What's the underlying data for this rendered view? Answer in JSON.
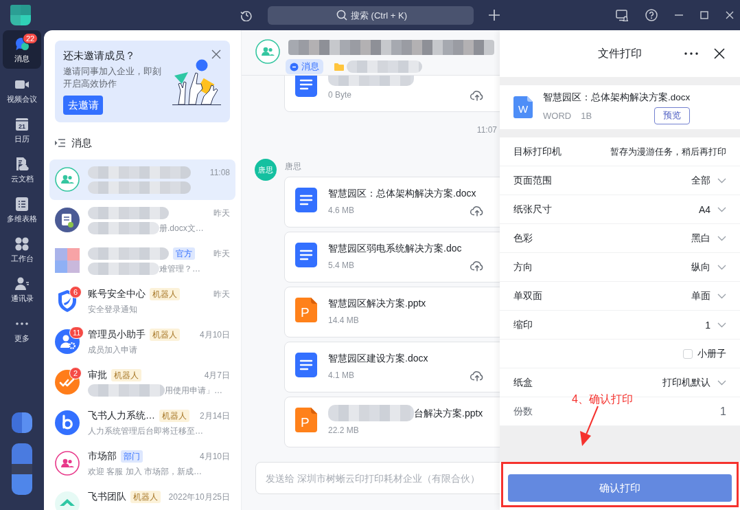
{
  "top_bar": {
    "search": {
      "placeholder": "搜索 (Ctrl + K)"
    }
  },
  "nav": {
    "items": [
      {
        "label": "消息",
        "selected": true,
        "badge": "22"
      },
      {
        "label": "视频会议",
        "selected": false
      },
      {
        "label": "日历",
        "selected": false,
        "date": "21"
      },
      {
        "label": "云文档",
        "selected": false
      },
      {
        "label": "多维表格",
        "selected": false
      },
      {
        "label": "工作台",
        "selected": false
      },
      {
        "label": "通讯录",
        "selected": false
      },
      {
        "label": "更多",
        "selected": false
      }
    ]
  },
  "invite_card": {
    "title": "还未邀请成员？",
    "text": "邀请同事加入企业，即刻开启高效协作",
    "button": "去邀请"
  },
  "chat_list": {
    "title": "消息",
    "items": [
      {
        "time": "11:08",
        "selected": true,
        "title_redacted": true,
        "preview_redacted": true
      },
      {
        "time": "昨天",
        "preview": "册.docx文…",
        "selected": false,
        "title_redacted": true,
        "preview_redacted": true
      },
      {
        "tag": {
          "label": "官方",
          "kind": "official"
        },
        "time": "昨天",
        "preview": "难管理？…",
        "selected": false,
        "title_redacted": true,
        "preview_redacted": true
      },
      {
        "title": "账号安全中心",
        "tag": {
          "label": "机器人",
          "kind": "bot"
        },
        "time": "昨天",
        "preview": "安全登录通知",
        "badge": "6",
        "selected": false,
        "title_redacted": false,
        "preview_redacted": false
      },
      {
        "title": "管理员小助手",
        "tag": {
          "label": "机器人",
          "kind": "bot"
        },
        "time": "4月10日",
        "preview": "成员加入申请",
        "badge": "11",
        "selected": false,
        "title_redacted": false,
        "preview_redacted": false
      },
      {
        "title": "审批",
        "tag": {
          "label": "机器人",
          "kind": "bot"
        },
        "time": "4月7日",
        "preview": "用使用申请」…",
        "badge": "2",
        "selected": false,
        "title_redacted": false,
        "preview_redacted": true
      },
      {
        "title": "飞书人力系统…",
        "tag": {
          "label": "机器人",
          "kind": "bot"
        },
        "time": "2月14日",
        "preview": "人力系统管理后台即将迁移至…",
        "selected": false,
        "title_redacted": false,
        "preview_redacted": false
      },
      {
        "title": "市场部",
        "tag": {
          "label": "部门",
          "kind": "department"
        },
        "time": "4月10日",
        "preview": "欢迎 客服 加入 市场部，新成…",
        "selected": false,
        "title_redacted": false,
        "preview_redacted": false
      },
      {
        "title": "飞书团队",
        "tag": {
          "label": "机器人",
          "kind": "bot"
        },
        "time": "2022年10月25日",
        "selected": false,
        "title_redacted": false,
        "preview_redacted": false
      }
    ]
  },
  "chat": {
    "tabs": [
      {
        "kind": "messages",
        "label": "消息",
        "selected": true,
        "redacted": false
      },
      {
        "kind": "files",
        "selected": false,
        "redacted": true
      }
    ],
    "messages": [
      {
        "kind": "document",
        "size": "0 Byte",
        "cloud_upload": true,
        "redacted": true
      },
      {
        "kind": "time",
        "text": "11:07"
      },
      {
        "kind": "sender",
        "avatar_text": "唐思",
        "name": "唐思"
      },
      {
        "kind": "document",
        "name": "智慧园区：总体架构解决方案.docx",
        "size": "4.6 MB",
        "cloud_upload": true,
        "redacted": false
      },
      {
        "kind": "document",
        "name": "智慧园区弱电系统解决方案.doc",
        "size": "5.4 MB",
        "cloud_upload": true,
        "redacted": false
      },
      {
        "kind": "presentation",
        "icon_text": "P",
        "name": "智慧园区解决方案.pptx",
        "size": "14.4 MB",
        "cloud_upload": false,
        "redacted": false
      },
      {
        "kind": "document",
        "name": "智慧园区建设方案.docx",
        "size": "4.1 MB",
        "cloud_upload": true,
        "redacted": false
      },
      {
        "kind": "presentation",
        "icon_text": "P",
        "name": "台解决方案.pptx",
        "size": "22.2 MB",
        "cloud_upload": false,
        "redacted": true
      }
    ],
    "input": {
      "placeholder": "发送给 深圳市树蜥云印打印耗材企业（有限合伙）"
    }
  },
  "print_panel": {
    "title": "文件打印",
    "file": {
      "icon_text": "W",
      "name": "智慧园区：总体架构解决方案.docx",
      "type": "WORD",
      "size": "1B",
      "preview_button": "预览"
    },
    "settings": [
      {
        "kind": "value",
        "label": "目标打印机",
        "value": "暂存为漫游任务，稍后再打印"
      },
      {
        "kind": "select",
        "label": "页面范围",
        "value": "全部"
      },
      {
        "kind": "select",
        "label": "纸张尺寸",
        "value": "A4"
      },
      {
        "kind": "select",
        "label": "色彩",
        "value": "黑白"
      },
      {
        "kind": "select",
        "label": "方向",
        "value": "纵向"
      },
      {
        "kind": "select",
        "label": "单双面",
        "value": "单面"
      },
      {
        "kind": "select",
        "label": "缩印",
        "value": "1"
      },
      {
        "kind": "checkbox",
        "label": "小册子",
        "checked": false
      },
      {
        "kind": "select",
        "label": "纸盒",
        "value": "打印机默认"
      },
      {
        "kind": "count",
        "label": "份数",
        "value": "1"
      }
    ],
    "confirm_button": "确认打印"
  },
  "annotation": {
    "text": "4、确认打印"
  }
}
